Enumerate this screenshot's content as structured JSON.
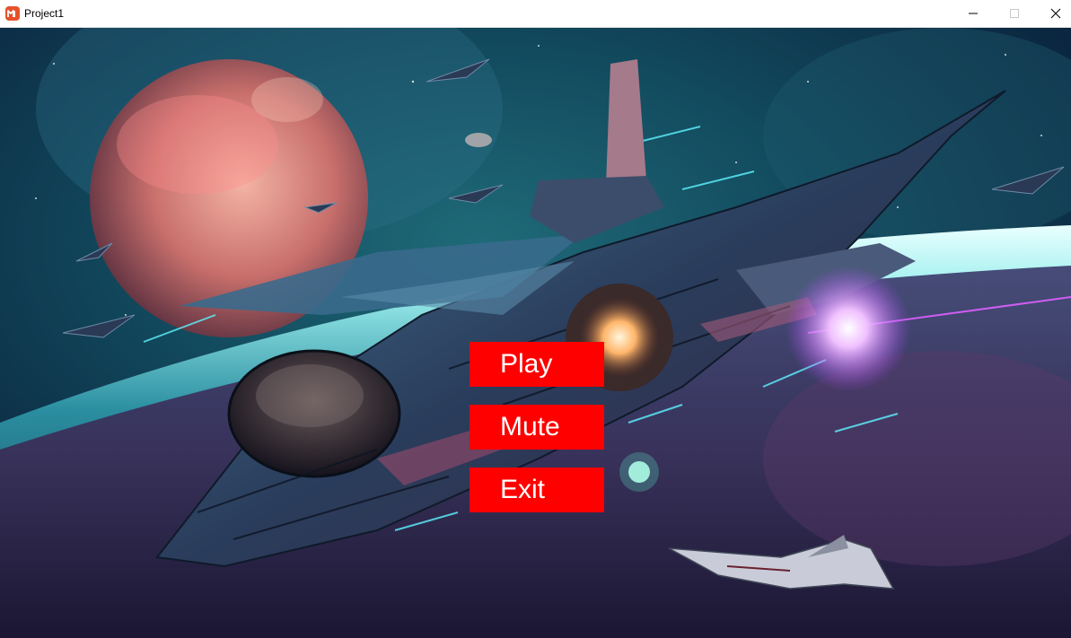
{
  "window": {
    "title": "Project1",
    "app_icon": "monogame-icon",
    "accent_color": "#e7512a",
    "controls": {
      "minimize_icon": "minimize-icon",
      "maximize_icon": "maximize-icon",
      "close_icon": "close-icon"
    }
  },
  "background": {
    "icon": "space-battle-background",
    "palette": {
      "deep_space": "#0a1a2e",
      "nebula_teal": "#2ec7c9",
      "planet_pink": "#e0827f",
      "ship_hull": "#2b3a55",
      "engine_glow": "#ffd8a8",
      "laser_magenta": "#d050ff"
    }
  },
  "menu": {
    "button_color": "#ff0000",
    "text_color": "#ffffff",
    "items": [
      {
        "label": "Play"
      },
      {
        "label": "Mute"
      },
      {
        "label": "Exit"
      }
    ]
  }
}
